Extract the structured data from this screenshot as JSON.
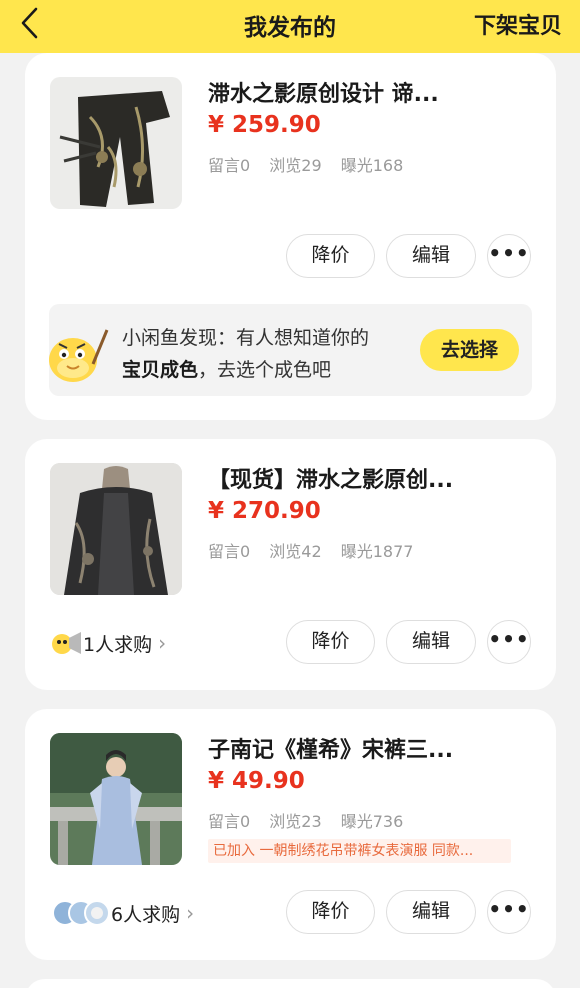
{
  "header": {
    "back_icon": "chevron-left-icon",
    "title": "我发布的",
    "right_action": "下架宝贝"
  },
  "colors": {
    "header_bg": "#ffe64d",
    "price": "#e8321e",
    "accent_button": "#ffe64d",
    "tag_text": "#e86a3d"
  },
  "items": [
    {
      "title": "滞水之影原创设计 谛...",
      "price": "¥ 259.90",
      "stats": {
        "comments": "留言0",
        "views": "浏览29",
        "exposure": "曝光168"
      },
      "buttons": {
        "price_cut": "降价",
        "edit": "编辑",
        "more": "•••"
      },
      "promo": {
        "line1": "小闲鱼发现：有人想知道你的",
        "line2_bold": "宝贝成色",
        "line2_rest": "，去选个成色吧",
        "button": "去选择",
        "mascot_icon": "fish-mascot-icon"
      }
    },
    {
      "title": "【现货】滞水之影原创...",
      "price": "¥ 270.90",
      "stats": {
        "comments": "留言0",
        "views": "浏览42",
        "exposure": "曝光1877"
      },
      "want": "1人求购",
      "buttons": {
        "price_cut": "降价",
        "edit": "编辑",
        "more": "•••"
      }
    },
    {
      "title": "子南记《槿希》宋裤三...",
      "price": "¥ 49.90",
      "stats": {
        "comments": "留言0",
        "views": "浏览23",
        "exposure": "曝光736"
      },
      "tag": "已加入 一朝制绣花吊带裤女表演服 同款...",
      "want": "6人求购",
      "buttons": {
        "price_cut": "降价",
        "edit": "编辑",
        "more": "•••"
      }
    }
  ]
}
